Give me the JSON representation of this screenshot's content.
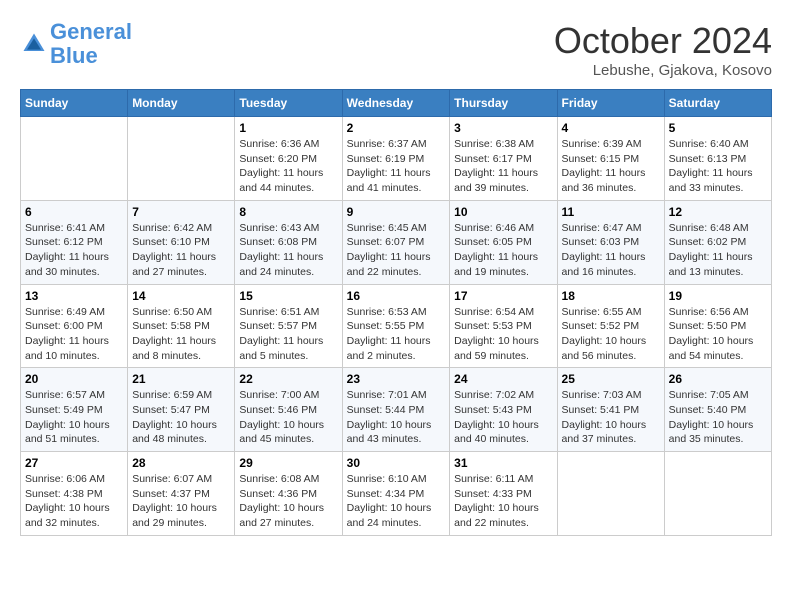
{
  "logo": {
    "line1": "General",
    "line2": "Blue"
  },
  "title": "October 2024",
  "location": "Lebushe, Gjakova, Kosovo",
  "weekdays": [
    "Sunday",
    "Monday",
    "Tuesday",
    "Wednesday",
    "Thursday",
    "Friday",
    "Saturday"
  ],
  "weeks": [
    [
      {
        "day": "",
        "sunrise": "",
        "sunset": "",
        "daylight": ""
      },
      {
        "day": "",
        "sunrise": "",
        "sunset": "",
        "daylight": ""
      },
      {
        "day": "1",
        "sunrise": "Sunrise: 6:36 AM",
        "sunset": "Sunset: 6:20 PM",
        "daylight": "Daylight: 11 hours and 44 minutes."
      },
      {
        "day": "2",
        "sunrise": "Sunrise: 6:37 AM",
        "sunset": "Sunset: 6:19 PM",
        "daylight": "Daylight: 11 hours and 41 minutes."
      },
      {
        "day": "3",
        "sunrise": "Sunrise: 6:38 AM",
        "sunset": "Sunset: 6:17 PM",
        "daylight": "Daylight: 11 hours and 39 minutes."
      },
      {
        "day": "4",
        "sunrise": "Sunrise: 6:39 AM",
        "sunset": "Sunset: 6:15 PM",
        "daylight": "Daylight: 11 hours and 36 minutes."
      },
      {
        "day": "5",
        "sunrise": "Sunrise: 6:40 AM",
        "sunset": "Sunset: 6:13 PM",
        "daylight": "Daylight: 11 hours and 33 minutes."
      }
    ],
    [
      {
        "day": "6",
        "sunrise": "Sunrise: 6:41 AM",
        "sunset": "Sunset: 6:12 PM",
        "daylight": "Daylight: 11 hours and 30 minutes."
      },
      {
        "day": "7",
        "sunrise": "Sunrise: 6:42 AM",
        "sunset": "Sunset: 6:10 PM",
        "daylight": "Daylight: 11 hours and 27 minutes."
      },
      {
        "day": "8",
        "sunrise": "Sunrise: 6:43 AM",
        "sunset": "Sunset: 6:08 PM",
        "daylight": "Daylight: 11 hours and 24 minutes."
      },
      {
        "day": "9",
        "sunrise": "Sunrise: 6:45 AM",
        "sunset": "Sunset: 6:07 PM",
        "daylight": "Daylight: 11 hours and 22 minutes."
      },
      {
        "day": "10",
        "sunrise": "Sunrise: 6:46 AM",
        "sunset": "Sunset: 6:05 PM",
        "daylight": "Daylight: 11 hours and 19 minutes."
      },
      {
        "day": "11",
        "sunrise": "Sunrise: 6:47 AM",
        "sunset": "Sunset: 6:03 PM",
        "daylight": "Daylight: 11 hours and 16 minutes."
      },
      {
        "day": "12",
        "sunrise": "Sunrise: 6:48 AM",
        "sunset": "Sunset: 6:02 PM",
        "daylight": "Daylight: 11 hours and 13 minutes."
      }
    ],
    [
      {
        "day": "13",
        "sunrise": "Sunrise: 6:49 AM",
        "sunset": "Sunset: 6:00 PM",
        "daylight": "Daylight: 11 hours and 10 minutes."
      },
      {
        "day": "14",
        "sunrise": "Sunrise: 6:50 AM",
        "sunset": "Sunset: 5:58 PM",
        "daylight": "Daylight: 11 hours and 8 minutes."
      },
      {
        "day": "15",
        "sunrise": "Sunrise: 6:51 AM",
        "sunset": "Sunset: 5:57 PM",
        "daylight": "Daylight: 11 hours and 5 minutes."
      },
      {
        "day": "16",
        "sunrise": "Sunrise: 6:53 AM",
        "sunset": "Sunset: 5:55 PM",
        "daylight": "Daylight: 11 hours and 2 minutes."
      },
      {
        "day": "17",
        "sunrise": "Sunrise: 6:54 AM",
        "sunset": "Sunset: 5:53 PM",
        "daylight": "Daylight: 10 hours and 59 minutes."
      },
      {
        "day": "18",
        "sunrise": "Sunrise: 6:55 AM",
        "sunset": "Sunset: 5:52 PM",
        "daylight": "Daylight: 10 hours and 56 minutes."
      },
      {
        "day": "19",
        "sunrise": "Sunrise: 6:56 AM",
        "sunset": "Sunset: 5:50 PM",
        "daylight": "Daylight: 10 hours and 54 minutes."
      }
    ],
    [
      {
        "day": "20",
        "sunrise": "Sunrise: 6:57 AM",
        "sunset": "Sunset: 5:49 PM",
        "daylight": "Daylight: 10 hours and 51 minutes."
      },
      {
        "day": "21",
        "sunrise": "Sunrise: 6:59 AM",
        "sunset": "Sunset: 5:47 PM",
        "daylight": "Daylight: 10 hours and 48 minutes."
      },
      {
        "day": "22",
        "sunrise": "Sunrise: 7:00 AM",
        "sunset": "Sunset: 5:46 PM",
        "daylight": "Daylight: 10 hours and 45 minutes."
      },
      {
        "day": "23",
        "sunrise": "Sunrise: 7:01 AM",
        "sunset": "Sunset: 5:44 PM",
        "daylight": "Daylight: 10 hours and 43 minutes."
      },
      {
        "day": "24",
        "sunrise": "Sunrise: 7:02 AM",
        "sunset": "Sunset: 5:43 PM",
        "daylight": "Daylight: 10 hours and 40 minutes."
      },
      {
        "day": "25",
        "sunrise": "Sunrise: 7:03 AM",
        "sunset": "Sunset: 5:41 PM",
        "daylight": "Daylight: 10 hours and 37 minutes."
      },
      {
        "day": "26",
        "sunrise": "Sunrise: 7:05 AM",
        "sunset": "Sunset: 5:40 PM",
        "daylight": "Daylight: 10 hours and 35 minutes."
      }
    ],
    [
      {
        "day": "27",
        "sunrise": "Sunrise: 6:06 AM",
        "sunset": "Sunset: 4:38 PM",
        "daylight": "Daylight: 10 hours and 32 minutes."
      },
      {
        "day": "28",
        "sunrise": "Sunrise: 6:07 AM",
        "sunset": "Sunset: 4:37 PM",
        "daylight": "Daylight: 10 hours and 29 minutes."
      },
      {
        "day": "29",
        "sunrise": "Sunrise: 6:08 AM",
        "sunset": "Sunset: 4:36 PM",
        "daylight": "Daylight: 10 hours and 27 minutes."
      },
      {
        "day": "30",
        "sunrise": "Sunrise: 6:10 AM",
        "sunset": "Sunset: 4:34 PM",
        "daylight": "Daylight: 10 hours and 24 minutes."
      },
      {
        "day": "31",
        "sunrise": "Sunrise: 6:11 AM",
        "sunset": "Sunset: 4:33 PM",
        "daylight": "Daylight: 10 hours and 22 minutes."
      },
      {
        "day": "",
        "sunrise": "",
        "sunset": "",
        "daylight": ""
      },
      {
        "day": "",
        "sunrise": "",
        "sunset": "",
        "daylight": ""
      }
    ]
  ]
}
